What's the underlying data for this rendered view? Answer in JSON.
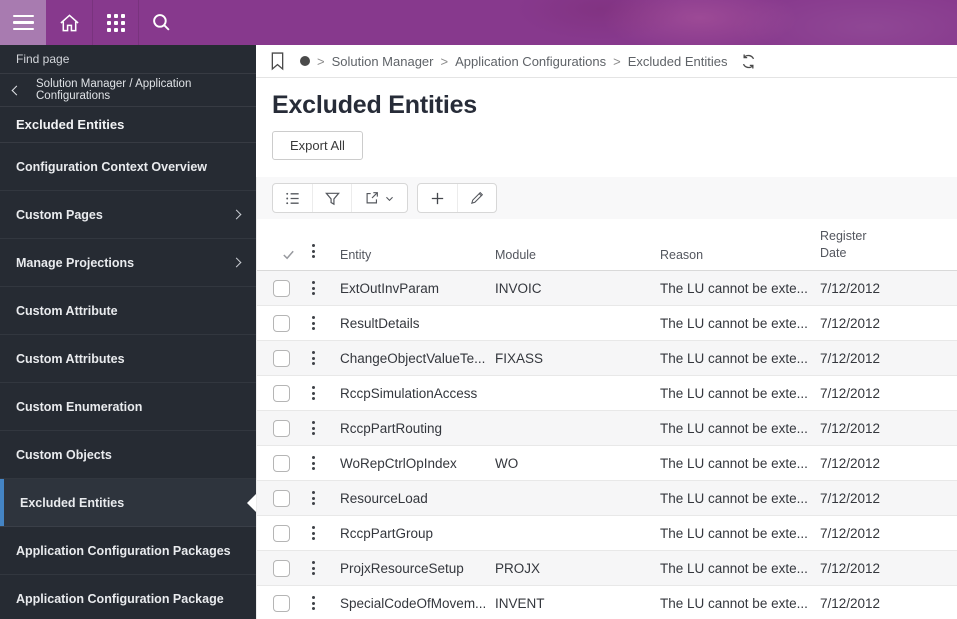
{
  "topbar": {
    "background": "#87398d",
    "menu_background": "#a87bb0"
  },
  "sidebar": {
    "find_page_label": "Find page",
    "back_label": "Solution Manager / Application Configurations",
    "section_title": "Excluded Entities",
    "accent_color": "#4484c4",
    "items": [
      {
        "label": "Configuration Context Overview",
        "expandable": false,
        "selected": false
      },
      {
        "label": "Custom Pages",
        "expandable": true,
        "selected": false
      },
      {
        "label": "Manage Projections",
        "expandable": true,
        "selected": false
      },
      {
        "label": "Custom Attribute",
        "expandable": false,
        "selected": false
      },
      {
        "label": "Custom Attributes",
        "expandable": false,
        "selected": false
      },
      {
        "label": "Custom Enumeration",
        "expandable": false,
        "selected": false
      },
      {
        "label": "Custom Objects",
        "expandable": false,
        "selected": false
      },
      {
        "label": "Excluded Entities",
        "expandable": false,
        "selected": true
      },
      {
        "label": "Application Configuration Packages",
        "expandable": false,
        "selected": false
      },
      {
        "label": "Application Configuration Package",
        "expandable": false,
        "selected": false
      }
    ]
  },
  "breadcrumb": {
    "separator": ">",
    "items": [
      "Solution Manager",
      "Application Configurations",
      "Excluded Entities"
    ]
  },
  "page": {
    "title": "Excluded Entities",
    "export_all_label": "Export All"
  },
  "table": {
    "columns": {
      "entity": "Entity",
      "module": "Module",
      "reason": "Reason",
      "register_date": "Register Date"
    },
    "rows": [
      {
        "entity": "ExtOutInvParam",
        "module": "INVOIC",
        "reason": "The LU cannot be exte...",
        "register_date": "7/12/2012"
      },
      {
        "entity": "ResultDetails",
        "module": "",
        "reason": "The LU cannot be exte...",
        "register_date": "7/12/2012"
      },
      {
        "entity": "ChangeObjectValueTe...",
        "module": "FIXASS",
        "reason": "The LU cannot be exte...",
        "register_date": "7/12/2012"
      },
      {
        "entity": "RccpSimulationAccess",
        "module": "",
        "reason": "The LU cannot be exte...",
        "register_date": "7/12/2012"
      },
      {
        "entity": "RccpPartRouting",
        "module": "",
        "reason": "The LU cannot be exte...",
        "register_date": "7/12/2012"
      },
      {
        "entity": "WoRepCtrlOpIndex",
        "module": "WO",
        "reason": "The LU cannot be exte...",
        "register_date": "7/12/2012"
      },
      {
        "entity": "ResourceLoad",
        "module": "",
        "reason": "The LU cannot be exte...",
        "register_date": "7/12/2012"
      },
      {
        "entity": "RccpPartGroup",
        "module": "",
        "reason": "The LU cannot be exte...",
        "register_date": "7/12/2012"
      },
      {
        "entity": "ProjxResourceSetup",
        "module": "PROJX",
        "reason": "The LU cannot be exte...",
        "register_date": "7/12/2012"
      },
      {
        "entity": "SpecialCodeOfMovem...",
        "module": "INVENT",
        "reason": "The LU cannot be exte...",
        "register_date": "7/12/2012"
      }
    ]
  }
}
